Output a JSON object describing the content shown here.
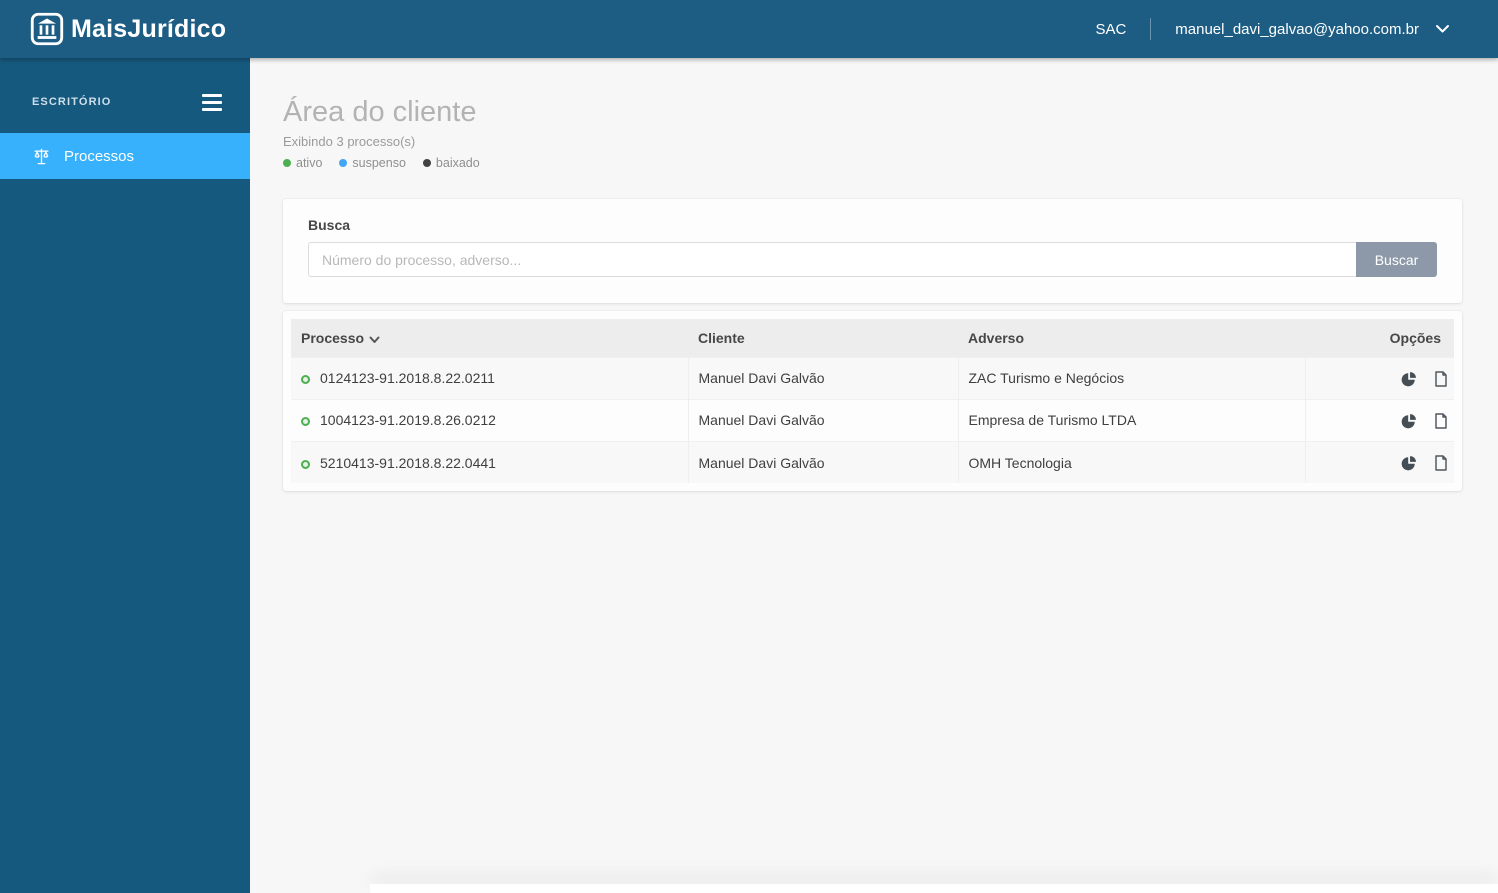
{
  "navbar": {
    "brand": "MaisJurídico",
    "sac_label": "SAC",
    "user_email": "manuel_davi_galvao@yahoo.com.br"
  },
  "sidebar": {
    "section_label": "ESCRITÓRIO",
    "items": [
      {
        "label": "Processos",
        "active": true
      }
    ]
  },
  "page": {
    "title": "Área do cliente",
    "subtitle": "Exibindo 3 processo(s)",
    "legend": [
      {
        "label": "ativo",
        "color": "#4caf50"
      },
      {
        "label": "suspenso",
        "color": "#42a5f5"
      },
      {
        "label": "baixado",
        "color": "#424242"
      }
    ]
  },
  "search": {
    "label": "Busca",
    "placeholder": "Número do processo, adverso...",
    "value": "",
    "button_label": "Buscar"
  },
  "table": {
    "columns": [
      "Processo",
      "Cliente",
      "Adverso",
      "Opções"
    ],
    "sorted_column": "Processo",
    "rows": [
      {
        "status": "ativo",
        "processo": "0124123-91.2018.8.22.0211",
        "cliente": "Manuel Davi Galvão",
        "adverso": "ZAC Turismo e Negócios"
      },
      {
        "status": "ativo",
        "processo": "1004123-91.2019.8.26.0212",
        "cliente": "Manuel Davi Galvão",
        "adverso": "Empresa de Turismo LTDA"
      },
      {
        "status": "ativo",
        "processo": "5210413-91.2018.8.22.0441",
        "cliente": "Manuel Davi Galvão",
        "adverso": "OMH Tecnologia"
      }
    ],
    "row_actions": [
      "pie-chart",
      "document"
    ]
  },
  "colors": {
    "navbar_bg": "#1d5d84",
    "sidebar_bg": "#16597f",
    "active_item_bg": "#38b1fd",
    "button_bg": "#8d99a8",
    "status_ativo": "#4caf50"
  }
}
